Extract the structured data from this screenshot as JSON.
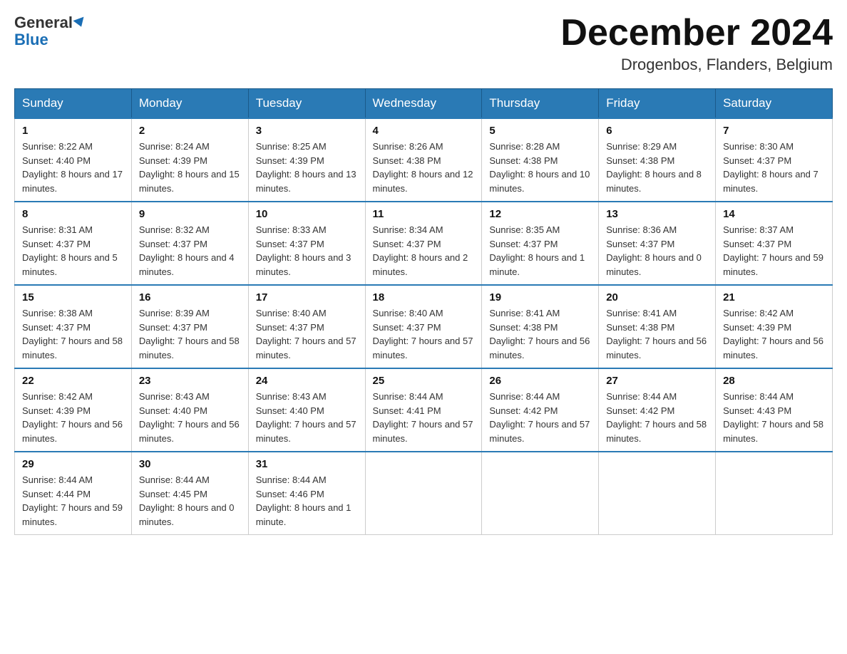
{
  "logo": {
    "general": "General",
    "blue": "Blue"
  },
  "title": "December 2024",
  "location": "Drogenbos, Flanders, Belgium",
  "days_of_week": [
    "Sunday",
    "Monday",
    "Tuesday",
    "Wednesday",
    "Thursday",
    "Friday",
    "Saturday"
  ],
  "weeks": [
    [
      {
        "date": "1",
        "sunrise": "8:22 AM",
        "sunset": "4:40 PM",
        "daylight": "8 hours and 17 minutes."
      },
      {
        "date": "2",
        "sunrise": "8:24 AM",
        "sunset": "4:39 PM",
        "daylight": "8 hours and 15 minutes."
      },
      {
        "date": "3",
        "sunrise": "8:25 AM",
        "sunset": "4:39 PM",
        "daylight": "8 hours and 13 minutes."
      },
      {
        "date": "4",
        "sunrise": "8:26 AM",
        "sunset": "4:38 PM",
        "daylight": "8 hours and 12 minutes."
      },
      {
        "date": "5",
        "sunrise": "8:28 AM",
        "sunset": "4:38 PM",
        "daylight": "8 hours and 10 minutes."
      },
      {
        "date": "6",
        "sunrise": "8:29 AM",
        "sunset": "4:38 PM",
        "daylight": "8 hours and 8 minutes."
      },
      {
        "date": "7",
        "sunrise": "8:30 AM",
        "sunset": "4:37 PM",
        "daylight": "8 hours and 7 minutes."
      }
    ],
    [
      {
        "date": "8",
        "sunrise": "8:31 AM",
        "sunset": "4:37 PM",
        "daylight": "8 hours and 5 minutes."
      },
      {
        "date": "9",
        "sunrise": "8:32 AM",
        "sunset": "4:37 PM",
        "daylight": "8 hours and 4 minutes."
      },
      {
        "date": "10",
        "sunrise": "8:33 AM",
        "sunset": "4:37 PM",
        "daylight": "8 hours and 3 minutes."
      },
      {
        "date": "11",
        "sunrise": "8:34 AM",
        "sunset": "4:37 PM",
        "daylight": "8 hours and 2 minutes."
      },
      {
        "date": "12",
        "sunrise": "8:35 AM",
        "sunset": "4:37 PM",
        "daylight": "8 hours and 1 minute."
      },
      {
        "date": "13",
        "sunrise": "8:36 AM",
        "sunset": "4:37 PM",
        "daylight": "8 hours and 0 minutes."
      },
      {
        "date": "14",
        "sunrise": "8:37 AM",
        "sunset": "4:37 PM",
        "daylight": "7 hours and 59 minutes."
      }
    ],
    [
      {
        "date": "15",
        "sunrise": "8:38 AM",
        "sunset": "4:37 PM",
        "daylight": "7 hours and 58 minutes."
      },
      {
        "date": "16",
        "sunrise": "8:39 AM",
        "sunset": "4:37 PM",
        "daylight": "7 hours and 58 minutes."
      },
      {
        "date": "17",
        "sunrise": "8:40 AM",
        "sunset": "4:37 PM",
        "daylight": "7 hours and 57 minutes."
      },
      {
        "date": "18",
        "sunrise": "8:40 AM",
        "sunset": "4:37 PM",
        "daylight": "7 hours and 57 minutes."
      },
      {
        "date": "19",
        "sunrise": "8:41 AM",
        "sunset": "4:38 PM",
        "daylight": "7 hours and 56 minutes."
      },
      {
        "date": "20",
        "sunrise": "8:41 AM",
        "sunset": "4:38 PM",
        "daylight": "7 hours and 56 minutes."
      },
      {
        "date": "21",
        "sunrise": "8:42 AM",
        "sunset": "4:39 PM",
        "daylight": "7 hours and 56 minutes."
      }
    ],
    [
      {
        "date": "22",
        "sunrise": "8:42 AM",
        "sunset": "4:39 PM",
        "daylight": "7 hours and 56 minutes."
      },
      {
        "date": "23",
        "sunrise": "8:43 AM",
        "sunset": "4:40 PM",
        "daylight": "7 hours and 56 minutes."
      },
      {
        "date": "24",
        "sunrise": "8:43 AM",
        "sunset": "4:40 PM",
        "daylight": "7 hours and 57 minutes."
      },
      {
        "date": "25",
        "sunrise": "8:44 AM",
        "sunset": "4:41 PM",
        "daylight": "7 hours and 57 minutes."
      },
      {
        "date": "26",
        "sunrise": "8:44 AM",
        "sunset": "4:42 PM",
        "daylight": "7 hours and 57 minutes."
      },
      {
        "date": "27",
        "sunrise": "8:44 AM",
        "sunset": "4:42 PM",
        "daylight": "7 hours and 58 minutes."
      },
      {
        "date": "28",
        "sunrise": "8:44 AM",
        "sunset": "4:43 PM",
        "daylight": "7 hours and 58 minutes."
      }
    ],
    [
      {
        "date": "29",
        "sunrise": "8:44 AM",
        "sunset": "4:44 PM",
        "daylight": "7 hours and 59 minutes."
      },
      {
        "date": "30",
        "sunrise": "8:44 AM",
        "sunset": "4:45 PM",
        "daylight": "8 hours and 0 minutes."
      },
      {
        "date": "31",
        "sunrise": "8:44 AM",
        "sunset": "4:46 PM",
        "daylight": "8 hours and 1 minute."
      },
      null,
      null,
      null,
      null
    ]
  ],
  "labels": {
    "sunrise": "Sunrise:",
    "sunset": "Sunset:",
    "daylight": "Daylight:"
  }
}
